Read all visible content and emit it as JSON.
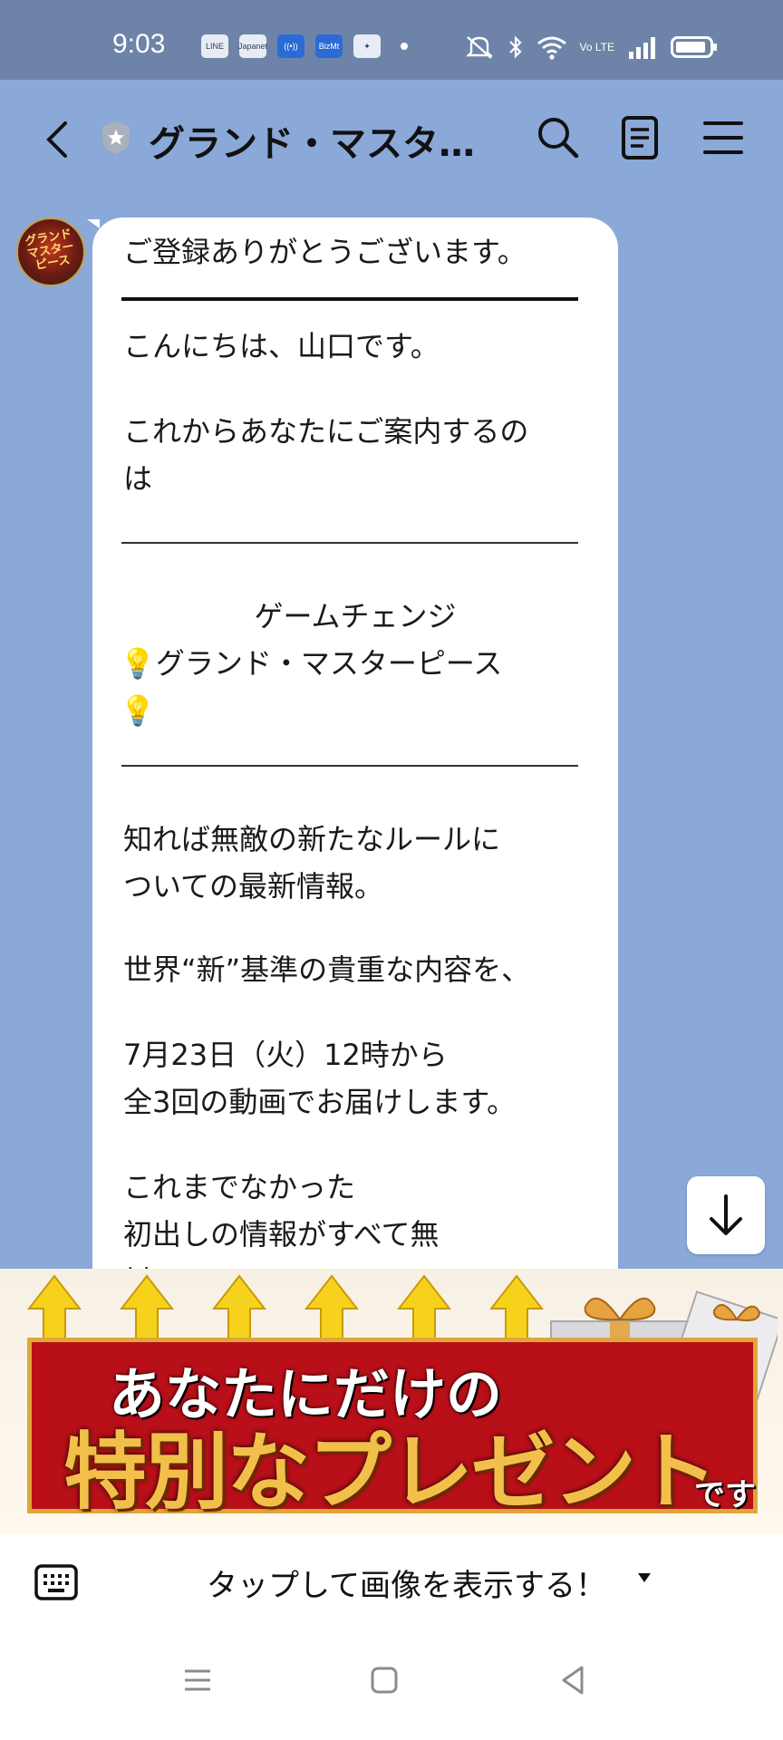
{
  "status_bar": {
    "time": "9:03",
    "notification_icons": [
      "LINE",
      "Japanet",
      "((•))",
      "BizMt",
      "✦"
    ],
    "right_text": "Vo LTE"
  },
  "header": {
    "title": "グランド・マスタ…"
  },
  "chat": {
    "avatar_text": "グランドマスターピース",
    "message": {
      "line1": "ご登録ありがとうございます。",
      "line2": "こんにちは、山口です。",
      "line3a": "これからあなたにご案内するの",
      "line3b": "は",
      "center1": "ゲームチェンジ",
      "center2": "💡グランド・マスターピース",
      "center3": "💡",
      "p1a": "知れば無敵の新たなルールに",
      "p1b": "ついての最新情報。",
      "p2": "世界“新”基準の貴重な内容を、",
      "p3a": "7月23日（火）12時から",
      "p3b": "全3回の動画でお届けします。",
      "p4a": "これまでなかった",
      "p4b": "初出しの情報がすべて無",
      "p4c": "料"
    }
  },
  "banner": {
    "line1": "あなたにだけの",
    "line2": "特別なプレゼント",
    "suffix": "です"
  },
  "input_bar": {
    "tap_label": "タップして画像を表示する！"
  },
  "colors": {
    "chat_background": "#8aa8d8",
    "status_bar": "#6d84a8",
    "bubble": "#ffffff",
    "banner_red": "#b80f18",
    "banner_gold": "#f2c04a"
  }
}
